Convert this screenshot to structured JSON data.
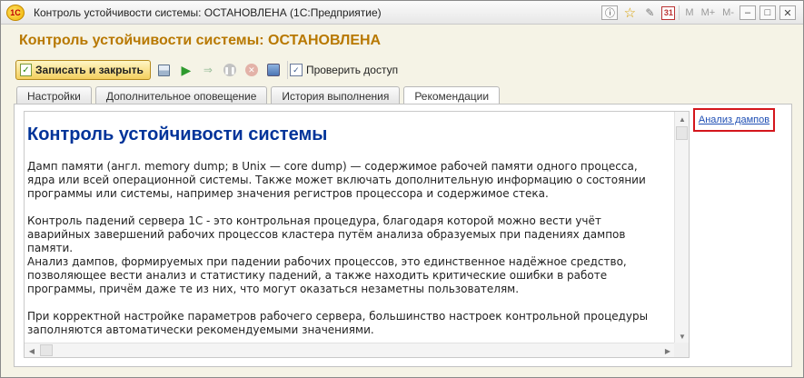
{
  "window": {
    "title": "Контроль устойчивости системы: ОСТАНОВЛЕНА  (1С:Предприятие)",
    "logo_text": "1С",
    "controls": {
      "mem": "M",
      "mem_plus": "M+",
      "mem_minus": "M-",
      "minimize": "–",
      "maximize": "□",
      "close": "✕"
    }
  },
  "form": {
    "heading": "Контроль устойчивости системы: ОСТАНОВЛЕНА"
  },
  "toolbar": {
    "save_close_label": "Записать и закрыть",
    "check_access_label": "Проверить доступ"
  },
  "tabs": [
    {
      "label": "Настройки",
      "active": false
    },
    {
      "label": "Дополнительное оповещение",
      "active": false
    },
    {
      "label": "История выполнения",
      "active": false
    },
    {
      "label": "Рекомендации",
      "active": true
    }
  ],
  "document": {
    "title": "Контроль устойчивости системы",
    "paragraphs": [
      {
        "lines": [
          "Дамп памяти (англ. memory dump; в Unix — core dump) — содержимое рабочей памяти одного процесса,",
          "ядра или всей операционной системы. Также может включать дополнительную информацию о состоянии",
          "программы или системы, например значения регистров процессора и содержимое стека."
        ]
      },
      {
        "lines": [
          "Контроль падений сервера 1С - это контрольная процедура, благодаря которой можно вести учёт",
          "аварийных завершений рабочих процессов кластера путём анализа образуемых при падениях дампов",
          "памяти.",
          "Анализ дампов, формируемых при падении рабочих процессов, это единственное надёжное средство,",
          "позволяющее вести анализ и статистику падений, а также находить критические ошибки в работе",
          "программы, причём даже те из них, что могут оказаться незаметны пользователям."
        ]
      },
      {
        "lines": [
          "При корректной настройке параметров рабочего сервера, большинство настроек контрольной процедуры",
          "заполняются автоматически рекомендуемыми значениями."
        ]
      }
    ]
  },
  "side_link": {
    "label": "Анализ дампов",
    "highlight_color": "#d4161c"
  },
  "colors": {
    "heading": "#b87800",
    "doc_title": "#003399",
    "link": "#1f4fb4",
    "primary_button": "#f4cf5e"
  },
  "icons": {
    "scroll_up": "▲",
    "scroll_down": "▼",
    "scroll_left": "◀",
    "scroll_right": "▶"
  }
}
